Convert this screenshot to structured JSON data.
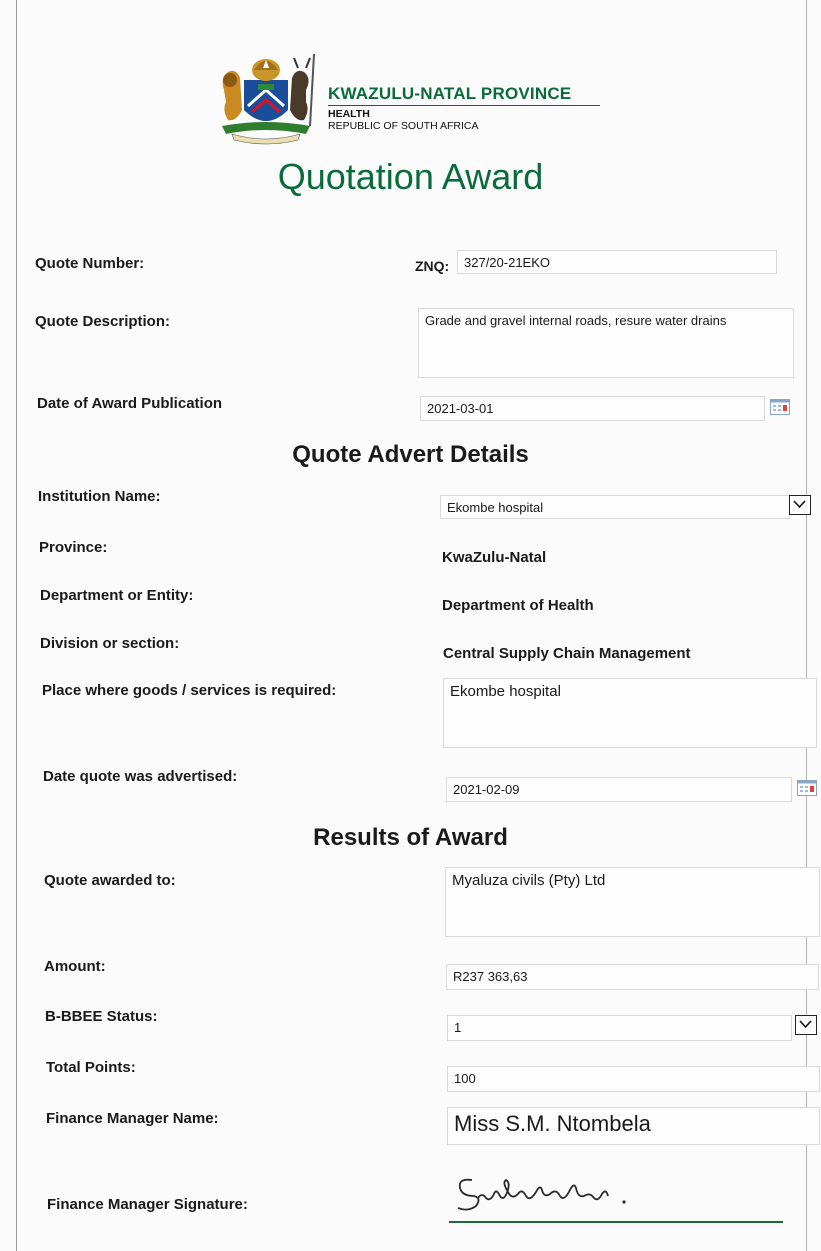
{
  "header": {
    "org_name": "KWAZULU-NATAL PROVINCE",
    "org_sub1": "HEALTH",
    "org_sub2": "REPUBLIC OF SOUTH AFRICA",
    "title": "Quotation Award"
  },
  "quote": {
    "number_label": "Quote Number:",
    "number_prefix": "ZNQ:",
    "number_value": "327/20-21EKO",
    "description_label": "Quote Description:",
    "description_value": "Grade and gravel internal roads, resure water drains",
    "award_date_label": "Date of Award Publication",
    "award_date_value": "2021-03-01"
  },
  "advert": {
    "heading": "Quote Advert Details",
    "institution_label": "Institution Name:",
    "institution_value": "Ekombe hospital",
    "province_label": "Province:",
    "province_value": "KwaZulu-Natal",
    "department_label": "Department or Entity:",
    "department_value": "Department of Health",
    "division_label": "Division or section:",
    "division_value": "Central Supply Chain Management",
    "place_label": "Place where goods /  services is required:",
    "place_value": "Ekombe hospital",
    "advertised_label": "Date quote was advertised:",
    "advertised_value": "2021-02-09"
  },
  "results": {
    "heading": "Results of Award",
    "awarded_to_label": "Quote awarded to:",
    "awarded_to_value": "Myaluza civils (Pty) Ltd",
    "amount_label": "Amount:",
    "amount_value": "R237 363,63",
    "bbbee_label": "B-BBEE Status:",
    "bbbee_value": "1",
    "points_label": "Total Points:",
    "points_value": "100",
    "fm_name_label": "Finance Manager Name:",
    "fm_name_value": "Miss S.M. Ntombela",
    "fm_signature_label": "Finance Manager Signature:"
  },
  "colors": {
    "brand_green": "#0a6b3a",
    "field_border": "#d9d9d9"
  },
  "icons": [
    "provincial-coat-of-arms-emblem",
    "calendar-icon",
    "dropdown-arrow-icon",
    "handwritten-signature"
  ]
}
